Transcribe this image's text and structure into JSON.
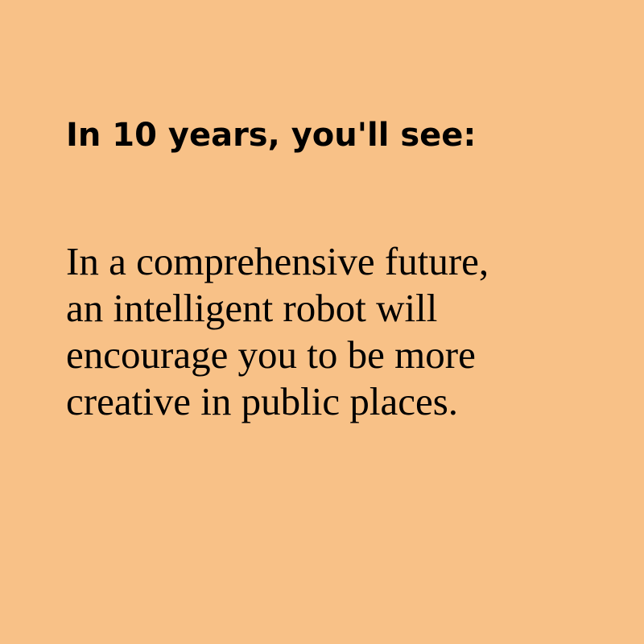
{
  "colors": {
    "background": "#f8c187",
    "text": "#000000"
  },
  "heading": "In 10 years, you'll see:",
  "body_lines": [
    "In a comprehensive future,",
    "an intelligent robot will",
    "encourage you to be more",
    "creative in public places."
  ]
}
